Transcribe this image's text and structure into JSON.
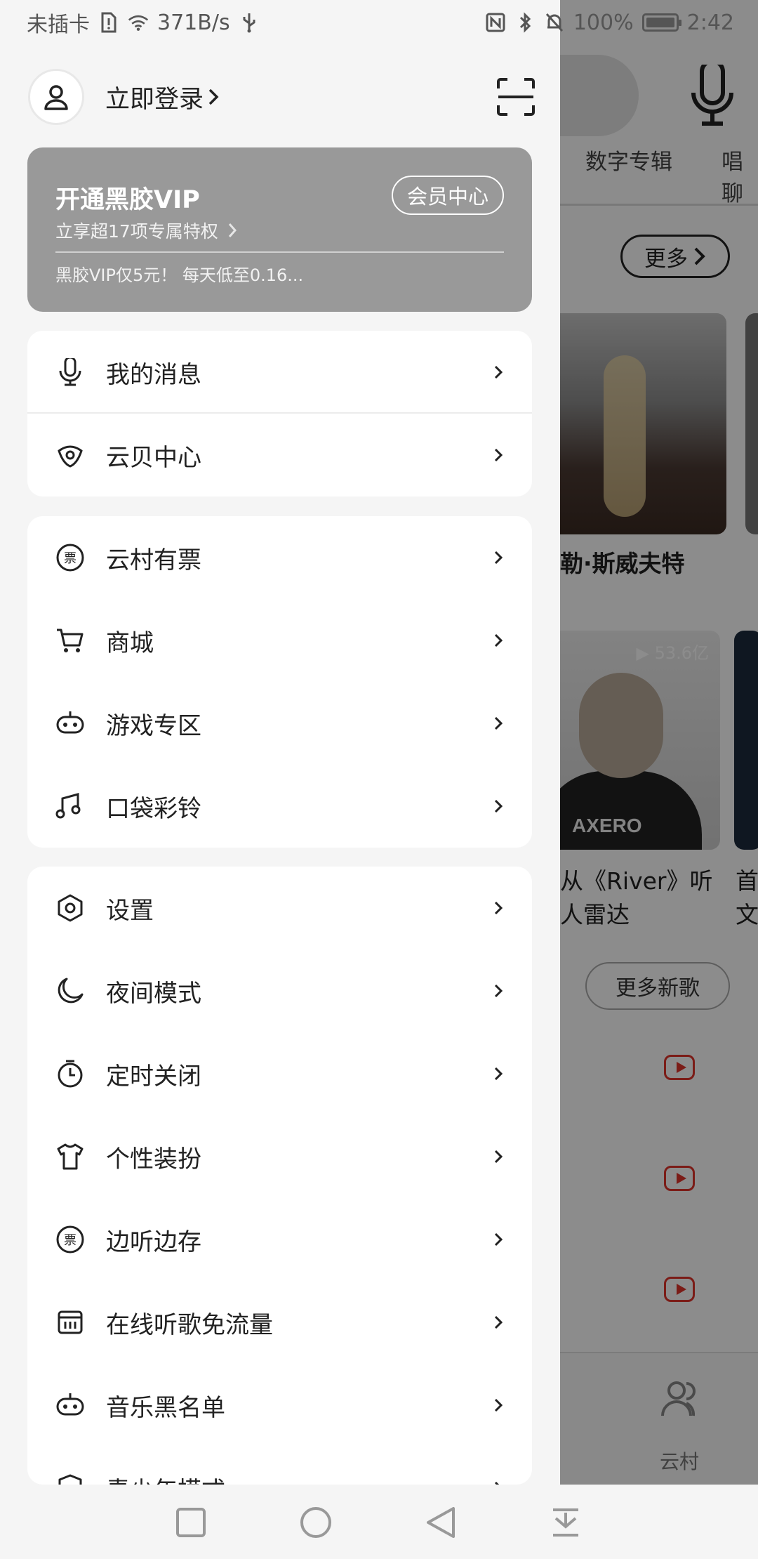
{
  "status_bar": {
    "carrier": "未插卡",
    "speed": "371B/s",
    "battery": "100%",
    "time": "2:42"
  },
  "drawer": {
    "login_label": "立即登录",
    "vip": {
      "title": "开通黑胶VIP",
      "subtitle": "立享超17项专属特权",
      "center_button": "会员中心",
      "promo": "黑胶VIP仅5元！ 每天低至0.16..."
    },
    "groups": [
      {
        "items": [
          {
            "label": "我的消息",
            "icon": "message-mic-icon"
          },
          {
            "label": "云贝中心",
            "icon": "cloud-shell-icon"
          }
        ]
      },
      {
        "items": [
          {
            "label": "云村有票",
            "icon": "ticket-icon"
          },
          {
            "label": "商城",
            "icon": "cart-icon"
          },
          {
            "label": "游戏专区",
            "icon": "gamepad-icon"
          },
          {
            "label": "口袋彩铃",
            "icon": "ringtone-icon"
          }
        ]
      },
      {
        "items": [
          {
            "label": "设置",
            "icon": "settings-hex-icon"
          },
          {
            "label": "夜间模式",
            "icon": "moon-icon"
          },
          {
            "label": "定时关闭",
            "icon": "timer-icon"
          },
          {
            "label": "个性装扮",
            "icon": "tshirt-icon"
          },
          {
            "label": "边听边存",
            "icon": "ticket-icon"
          },
          {
            "label": "在线听歌免流量",
            "icon": "sim-card-icon"
          },
          {
            "label": "音乐黑名单",
            "icon": "gamepad-icon"
          },
          {
            "label": "青少年模式",
            "icon": "shield-icon"
          }
        ]
      }
    ]
  },
  "background_app": {
    "tabs": [
      "数字专辑",
      "唱聊"
    ],
    "more_button": "更多",
    "artist_card_caption": "勒·斯威夫特",
    "video_plays": "53.6亿",
    "video_brand": "AXERO",
    "song_caption_line1": "从《River》听",
    "song_caption_line2": "人雷达",
    "side_caption_1": "首",
    "side_caption_2": "文",
    "more_songs_button": "更多新歌",
    "bottom_tab_label": "云村"
  },
  "colors": {
    "vip_card_bg": "#999999",
    "drawer_bg": "#f5f5f5",
    "accent_red": "#e0332a"
  }
}
